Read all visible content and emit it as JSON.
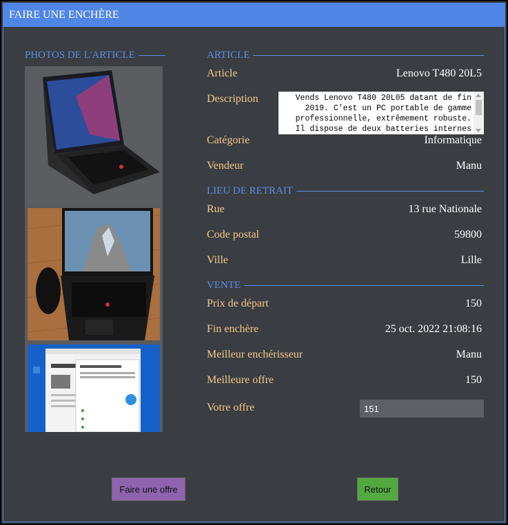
{
  "window": {
    "title": "FAIRE UNE ENCHÈRE"
  },
  "photos": {
    "legend": "PHOTOS DE L'ARTICLE",
    "images": [
      "laptop-gray-background",
      "laptop-on-wooden-floor",
      "windows-screen-integrity-check"
    ]
  },
  "article": {
    "section_title": "ARTICLE",
    "name_label": "Article",
    "name_value": "Lenovo T480 20L5",
    "description_label": "Description",
    "description_value": "Vends Lenovo T480 20L05 datant de fin\n2019. C'est un PC portable de gamme\nprofessionnelle, extrêmement robuste.\nIl dispose de deux batteries internes",
    "category_label": "Catégorie",
    "category_value": "Informatique",
    "seller_label": "Vendeur",
    "seller_value": "Manu"
  },
  "pickup": {
    "section_title": "LIEU DE RETRAIT",
    "street_label": "Rue",
    "street_value": "13 rue Nationale",
    "postal_label": "Code postal",
    "postal_value": "59800",
    "city_label": "Ville",
    "city_value": "Lille"
  },
  "sale": {
    "section_title": "VENTE",
    "start_price_label": "Prix de départ",
    "start_price_value": "150",
    "end_label": "Fin enchère",
    "end_value": "25 oct. 2022 21:08:16",
    "best_bidder_label": "Meilleur enchérisseur",
    "best_bidder_value": "Manu",
    "best_offer_label": "Meilleure offre",
    "best_offer_value": "150",
    "your_offer_label": "Votre offre",
    "your_offer_value": "151"
  },
  "buttons": {
    "make_offer": "Faire une offre",
    "back": "Retour"
  },
  "colors": {
    "titlebar": "#4f86e6",
    "background": "#3a3d41",
    "label": "#f4c98b",
    "section": "#5b8ee8",
    "offer_button": "#8f63ae",
    "back_button": "#53a93f"
  }
}
